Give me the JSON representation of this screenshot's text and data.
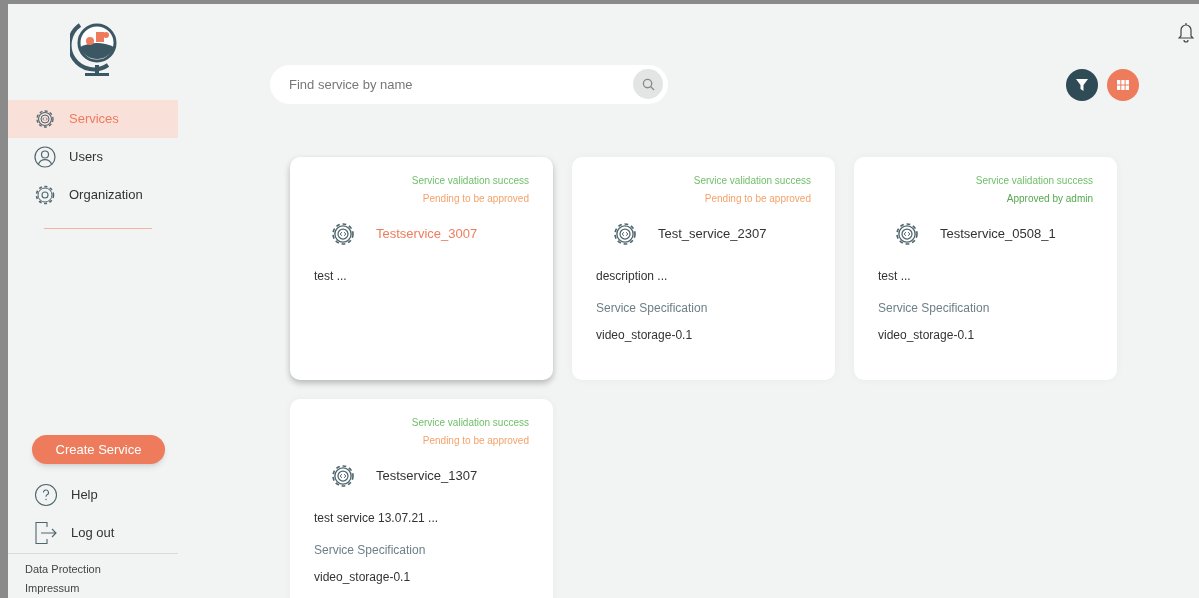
{
  "sidebar": {
    "nav": [
      {
        "label": "Services",
        "selected": true
      },
      {
        "label": "Users",
        "selected": false
      },
      {
        "label": "Organization",
        "selected": false
      }
    ],
    "create_button": "Create Service",
    "bottom": [
      {
        "label": "Help"
      },
      {
        "label": "Log out"
      }
    ],
    "footer_links": [
      "Data Protection",
      "Impressum"
    ]
  },
  "search": {
    "placeholder": "Find service by name"
  },
  "cards": [
    {
      "validation": "Service validation success",
      "approval": {
        "text": "Pending to be approved",
        "kind": "pending"
      },
      "name": "Testservice_3007",
      "hovered": true,
      "description": "test ..."
    },
    {
      "validation": "Service validation success",
      "approval": {
        "text": "Pending to be approved",
        "kind": "pending"
      },
      "name": "Test_service_2307",
      "hovered": false,
      "description": "description ...",
      "spec_label": "Service Specification",
      "spec_value": "video_storage-0.1"
    },
    {
      "validation": "Service validation success",
      "approval": {
        "text": "Approved by admin",
        "kind": "approved"
      },
      "name": "Testservice_0508_1",
      "hovered": false,
      "description": "test ...",
      "spec_label": "Service Specification",
      "spec_value": "video_storage-0.1"
    },
    {
      "validation": "Service validation success",
      "approval": {
        "text": "Pending to be approved",
        "kind": "pending"
      },
      "name": "Testservice_1307",
      "hovered": false,
      "description": "test service 13.07.21 ...",
      "spec_label": "Service Specification",
      "spec_value": "video_storage-0.1"
    }
  ]
}
